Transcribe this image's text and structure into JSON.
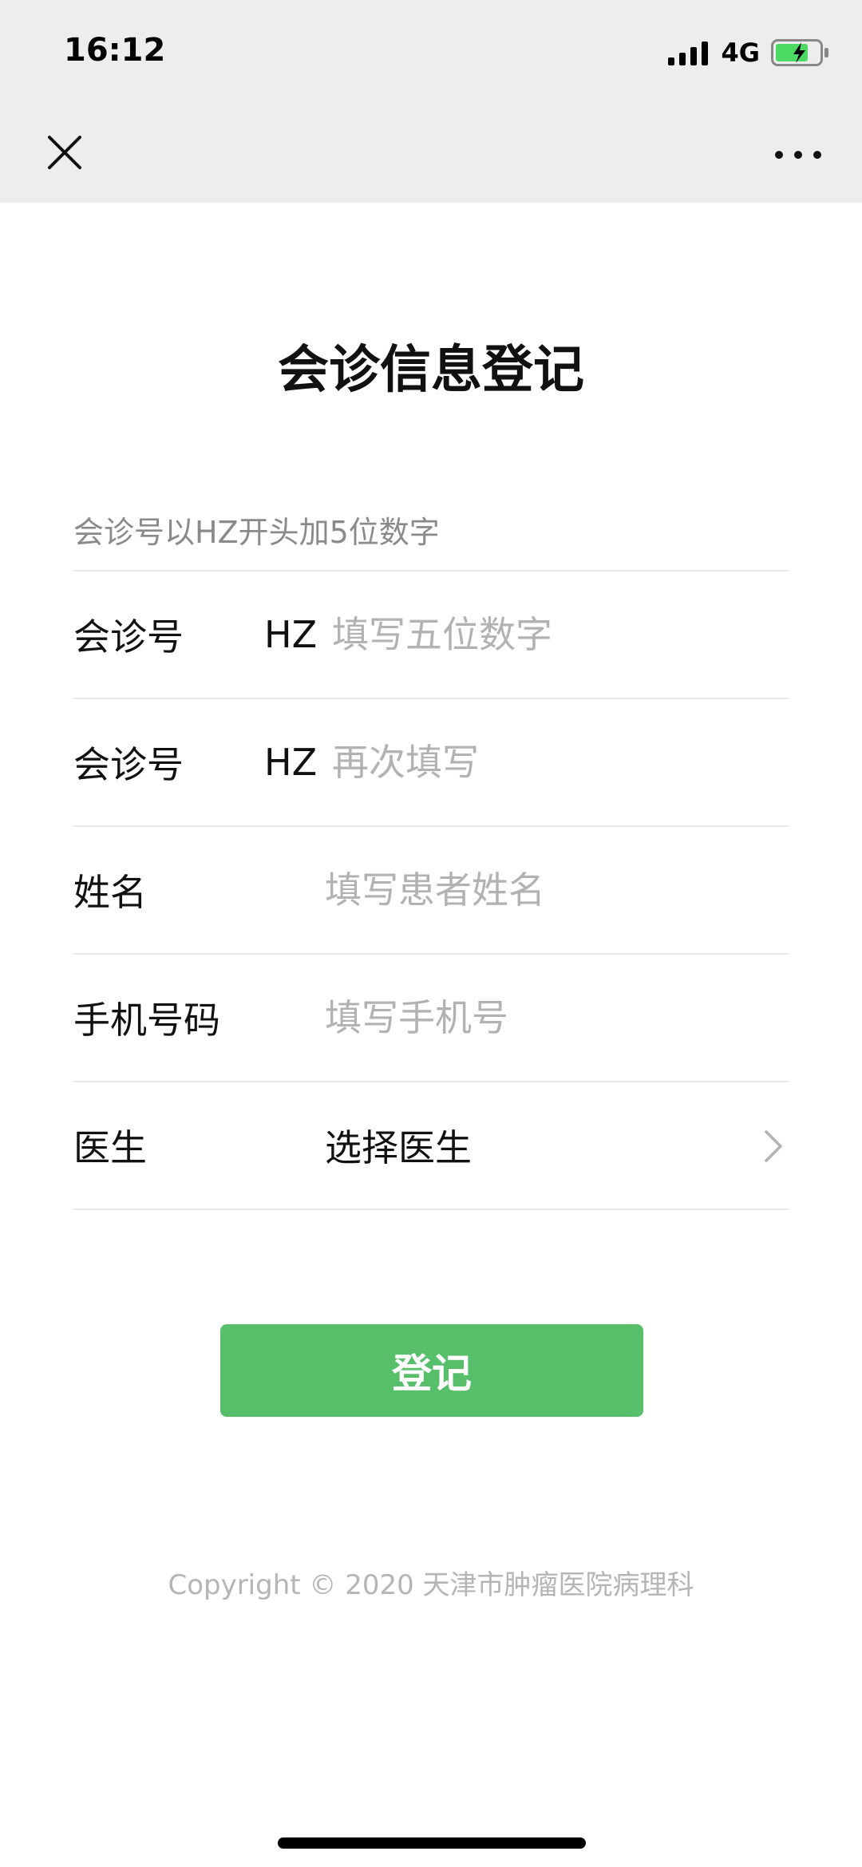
{
  "status_bar": {
    "time": "16:12",
    "network": "4G",
    "icons": [
      "signal-icon",
      "battery-charging-icon"
    ]
  },
  "nav_bar": {
    "icons": [
      "close-icon",
      "more-icon"
    ]
  },
  "page": {
    "title": "会诊信息登记",
    "hint": "会诊号以HZ开头加5位数字"
  },
  "form": {
    "rows": [
      {
        "label": "会诊号",
        "prefix": "HZ",
        "placeholder": "填写五位数字",
        "value": ""
      },
      {
        "label": "会诊号",
        "prefix": "HZ",
        "placeholder": "再次填写",
        "value": ""
      },
      {
        "label": "姓名",
        "placeholder": "填写患者姓名",
        "value": ""
      },
      {
        "label": "手机号码",
        "placeholder": "填写手机号",
        "value": ""
      },
      {
        "label": "医生",
        "select_value": "选择医生",
        "icon": "chevron-right-icon"
      }
    ]
  },
  "submit": {
    "label": "登记",
    "color": "#57be6a"
  },
  "footer": {
    "copyright": "Copyright © 2020 天津市肿瘤医院病理科"
  }
}
